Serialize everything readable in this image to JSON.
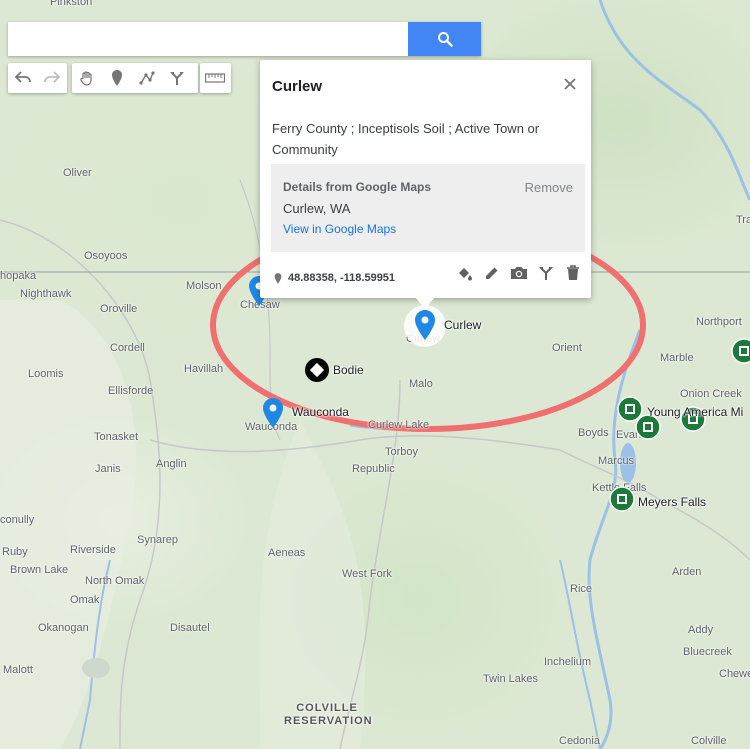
{
  "search": {
    "value": "",
    "placeholder": ""
  },
  "toolbar": {
    "tools": [
      "undo-icon",
      "redo-icon",
      "hand-icon",
      "marker-icon",
      "line-icon",
      "route-icon",
      "ruler-icon"
    ]
  },
  "map": {
    "places": [
      {
        "name": "Pinkston"
      },
      {
        "name": "Oliver"
      },
      {
        "name": "Osoyoos"
      },
      {
        "name": "hopaka"
      },
      {
        "name": "Nighthawk"
      },
      {
        "name": "Oroville"
      },
      {
        "name": "Molson"
      },
      {
        "name": "Chesaw"
      },
      {
        "name": "Cordell"
      },
      {
        "name": "Havillah"
      },
      {
        "name": "Loomis"
      },
      {
        "name": "Ellisforde"
      },
      {
        "name": "Tonasket"
      },
      {
        "name": "Janis"
      },
      {
        "name": "Anglin"
      },
      {
        "name": "Wauconda"
      },
      {
        "name": "Curlew"
      },
      {
        "name": "Malo"
      },
      {
        "name": "Curlew Lake"
      },
      {
        "name": "Torboy"
      },
      {
        "name": "Republic"
      },
      {
        "name": "Orient"
      },
      {
        "name": "Boyds"
      },
      {
        "name": "Evans"
      },
      {
        "name": "Marcus"
      },
      {
        "name": "Kettle Falls"
      },
      {
        "name": "Northport"
      },
      {
        "name": "Marble"
      },
      {
        "name": "Onion Creek"
      },
      {
        "name": "Aeneas"
      },
      {
        "name": "Synarep"
      },
      {
        "name": "Riverside"
      },
      {
        "name": "conully"
      },
      {
        "name": "Ruby"
      },
      {
        "name": "Brown Lake"
      },
      {
        "name": "North Omak"
      },
      {
        "name": "Omak"
      },
      {
        "name": "West Fork"
      },
      {
        "name": "Okanogan"
      },
      {
        "name": "Disautel"
      },
      {
        "name": "Malott"
      },
      {
        "name": "COLVILLE RESERVATION"
      },
      {
        "name": "Twin Lakes"
      },
      {
        "name": "Inchelium"
      },
      {
        "name": "Rice"
      },
      {
        "name": "Arden"
      },
      {
        "name": "Addy"
      },
      {
        "name": "Bluecreek"
      },
      {
        "name": "Chewe"
      },
      {
        "name": "Colville"
      },
      {
        "name": "Cedonia"
      },
      {
        "name": "Tra"
      }
    ],
    "markers": [
      {
        "label": "Curlew",
        "type": "blue-pin"
      },
      {
        "label": "Bodie",
        "type": "diamond"
      },
      {
        "label": "Wauconda",
        "type": "blue-pin"
      },
      {
        "label": "Young America Mi",
        "type": "green-square"
      },
      {
        "label": "Meyers Falls",
        "type": "green-square"
      }
    ],
    "colors": {
      "highlight_ellipse": "#f07070",
      "pin": "#1e88e5",
      "mine": "#1b7a3a"
    }
  },
  "popup": {
    "title": "Curlew",
    "description": "Ferry County ; Inceptisols Soil ; Active Town or Community",
    "details_heading": "Details from Google Maps",
    "remove_label": "Remove",
    "address": "Curlew, WA",
    "link_text": "View in Google Maps",
    "coordinates": "48.88358, -118.59951",
    "actions": [
      "paint-bucket-icon",
      "edit-pencil-icon",
      "camera-icon",
      "directions-icon",
      "trash-icon"
    ]
  }
}
